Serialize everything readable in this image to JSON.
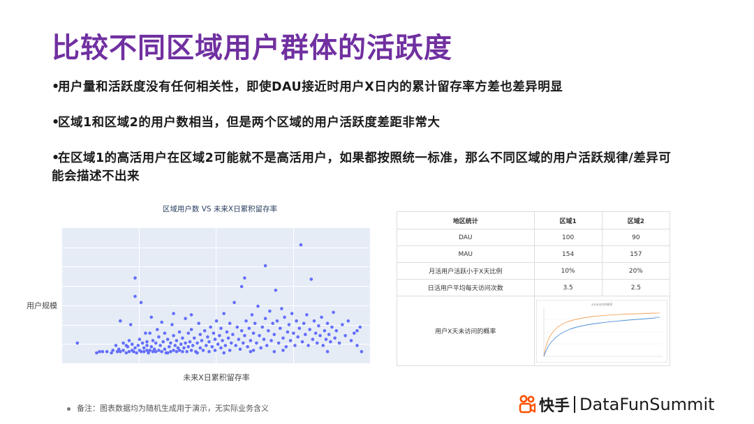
{
  "slide": {
    "title": "比较不同区域用户群体的活跃度",
    "bullets": [
      "用户量和活跃度没有任何相关性，即使DAU接近时用户X日内的累计留存率方差也差异明显",
      "区域1和区域2的用户数相当，但是两个区域的用户活跃度差距非常大",
      "在区域1的高活用户在区域2可能就不是高活用户，如果都按照统一标准，那么不同区域的用户活跃规律/差异可能会描述不出来"
    ],
    "bullet_mark": "•"
  },
  "chart_data": {
    "type": "scatter",
    "title": "区域用户数 VS 未来X日累积留存率",
    "xlabel": "未来X日累积留存率",
    "ylabel": "用户规模",
    "grid": true,
    "background": "#e5ecf6",
    "marker_color": "#636efa",
    "x_range": [
      0,
      1
    ],
    "y_range": [
      0,
      1
    ],
    "points": [
      [
        0.035,
        0.12
      ],
      [
        0.11,
        0.05
      ],
      [
        0.135,
        0.05
      ],
      [
        0.155,
        0.06
      ],
      [
        0.165,
        0.1
      ],
      [
        0.17,
        0.05
      ],
      [
        0.175,
        0.07
      ],
      [
        0.18,
        0.05
      ],
      [
        0.19,
        0.12
      ],
      [
        0.19,
        0.06
      ],
      [
        0.2,
        0.04
      ],
      [
        0.205,
        0.09
      ],
      [
        0.21,
        0.05
      ],
      [
        0.21,
        0.14
      ],
      [
        0.22,
        0.06
      ],
      [
        0.22,
        0.11
      ],
      [
        0.225,
        0.05
      ],
      [
        0.23,
        0.08
      ],
      [
        0.235,
        0.04
      ],
      [
        0.24,
        0.1
      ],
      [
        0.245,
        0.06
      ],
      [
        0.245,
        0.15
      ],
      [
        0.25,
        0.05
      ],
      [
        0.255,
        0.12
      ],
      [
        0.26,
        0.08
      ],
      [
        0.26,
        0.05
      ],
      [
        0.265,
        0.2
      ],
      [
        0.27,
        0.06
      ],
      [
        0.27,
        0.1
      ],
      [
        0.275,
        0.04
      ],
      [
        0.28,
        0.06
      ],
      [
        0.285,
        0.09
      ],
      [
        0.29,
        0.05
      ],
      [
        0.29,
        0.14
      ],
      [
        0.295,
        0.07
      ],
      [
        0.3,
        0.05
      ],
      [
        0.3,
        0.12
      ],
      [
        0.305,
        0.23
      ],
      [
        0.31,
        0.06
      ],
      [
        0.31,
        0.17
      ],
      [
        0.315,
        0.1
      ],
      [
        0.32,
        0.05
      ],
      [
        0.325,
        0.13
      ],
      [
        0.33,
        0.07
      ],
      [
        0.33,
        0.2
      ],
      [
        0.335,
        0.04
      ],
      [
        0.34,
        0.15
      ],
      [
        0.345,
        0.09
      ],
      [
        0.35,
        0.05
      ],
      [
        0.35,
        0.12
      ],
      [
        0.355,
        0.27
      ],
      [
        0.36,
        0.06
      ],
      [
        0.36,
        0.18
      ],
      [
        0.365,
        0.1
      ],
      [
        0.37,
        0.05
      ],
      [
        0.37,
        0.14
      ],
      [
        0.375,
        0.08
      ],
      [
        0.38,
        0.06
      ],
      [
        0.38,
        0.21
      ],
      [
        0.385,
        0.11
      ],
      [
        0.39,
        0.05
      ],
      [
        0.39,
        0.16
      ],
      [
        0.395,
        0.08
      ],
      [
        0.4,
        0.32
      ],
      [
        0.4,
        0.12
      ],
      [
        0.405,
        0.05
      ],
      [
        0.41,
        0.2
      ],
      [
        0.41,
        0.09
      ],
      [
        0.415,
        0.13
      ],
      [
        0.42,
        0.06
      ],
      [
        0.42,
        0.23
      ],
      [
        0.425,
        0.1
      ],
      [
        0.43,
        0.16
      ],
      [
        0.435,
        0.05
      ],
      [
        0.44,
        0.12
      ],
      [
        0.445,
        0.28
      ],
      [
        0.45,
        0.08
      ],
      [
        0.45,
        0.19
      ],
      [
        0.455,
        0.14
      ],
      [
        0.46,
        0.06
      ],
      [
        0.465,
        0.22
      ],
      [
        0.47,
        0.1
      ],
      [
        0.475,
        0.17
      ],
      [
        0.48,
        0.05
      ],
      [
        0.48,
        0.13
      ],
      [
        0.485,
        0.25
      ],
      [
        0.49,
        0.09
      ],
      [
        0.495,
        0.2
      ],
      [
        0.5,
        0.15
      ],
      [
        0.5,
        0.06
      ],
      [
        0.505,
        0.3
      ],
      [
        0.51,
        0.11
      ],
      [
        0.515,
        0.18
      ],
      [
        0.52,
        0.24
      ],
      [
        0.52,
        0.08
      ],
      [
        0.525,
        0.14
      ],
      [
        0.53,
        0.36
      ],
      [
        0.535,
        0.1
      ],
      [
        0.54,
        0.21
      ],
      [
        0.545,
        0.16
      ],
      [
        0.55,
        0.06
      ],
      [
        0.55,
        0.28
      ],
      [
        0.555,
        0.12
      ],
      [
        0.56,
        0.19
      ],
      [
        0.565,
        0.45
      ],
      [
        0.57,
        0.1
      ],
      [
        0.575,
        0.25
      ],
      [
        0.58,
        0.15
      ],
      [
        0.585,
        0.07
      ],
      [
        0.59,
        0.22
      ],
      [
        0.59,
        0.58
      ],
      [
        0.595,
        0.12
      ],
      [
        0.6,
        0.18
      ],
      [
        0.6,
        0.65
      ],
      [
        0.605,
        0.3
      ],
      [
        0.61,
        0.09
      ],
      [
        0.615,
        0.24
      ],
      [
        0.62,
        0.14
      ],
      [
        0.625,
        0.35
      ],
      [
        0.63,
        0.06
      ],
      [
        0.63,
        0.2
      ],
      [
        0.635,
        0.28
      ],
      [
        0.64,
        0.12
      ],
      [
        0.645,
        0.42
      ],
      [
        0.65,
        0.18
      ],
      [
        0.655,
        0.08
      ],
      [
        0.66,
        0.25
      ],
      [
        0.665,
        0.15
      ],
      [
        0.67,
        0.32
      ],
      [
        0.67,
        0.75
      ],
      [
        0.675,
        0.1
      ],
      [
        0.68,
        0.22
      ],
      [
        0.685,
        0.38
      ],
      [
        0.69,
        0.14
      ],
      [
        0.695,
        0.28
      ],
      [
        0.7,
        0.05
      ],
      [
        0.7,
        0.19
      ],
      [
        0.705,
        0.55
      ],
      [
        0.71,
        0.3
      ],
      [
        0.715,
        0.12
      ],
      [
        0.72,
        0.24
      ],
      [
        0.725,
        0.4
      ],
      [
        0.73,
        0.16
      ],
      [
        0.735,
        0.33
      ],
      [
        0.74,
        0.09
      ],
      [
        0.745,
        0.21
      ],
      [
        0.75,
        0.27
      ],
      [
        0.755,
        0.14
      ],
      [
        0.76,
        0.36
      ],
      [
        0.765,
        0.2
      ],
      [
        0.77,
        0.1
      ],
      [
        0.775,
        0.3
      ],
      [
        0.78,
        0.17
      ],
      [
        0.785,
        0.24
      ],
      [
        0.79,
        0.92
      ],
      [
        0.795,
        0.13
      ],
      [
        0.8,
        0.28
      ],
      [
        0.805,
        0.19
      ],
      [
        0.81,
        0.35
      ],
      [
        0.815,
        0.1
      ],
      [
        0.82,
        0.23
      ],
      [
        0.825,
        0.64
      ],
      [
        0.83,
        0.15
      ],
      [
        0.835,
        0.3
      ],
      [
        0.84,
        0.2
      ],
      [
        0.845,
        0.12
      ],
      [
        0.85,
        0.26
      ],
      [
        0.855,
        0.18
      ],
      [
        0.86,
        0.33
      ],
      [
        0.865,
        0.1
      ],
      [
        0.87,
        0.22
      ],
      [
        0.875,
        0.15
      ],
      [
        0.88,
        0.28
      ],
      [
        0.885,
        0.19
      ],
      [
        0.89,
        0.13
      ],
      [
        0.895,
        0.25
      ],
      [
        0.9,
        0.37
      ],
      [
        0.905,
        0.16
      ],
      [
        0.91,
        0.22
      ],
      [
        0.92,
        0.12
      ],
      [
        0.93,
        0.27
      ],
      [
        0.94,
        0.18
      ],
      [
        0.95,
        0.3
      ],
      [
        0.96,
        0.14
      ],
      [
        0.97,
        0.2
      ],
      [
        0.98,
        0.1
      ],
      [
        0.99,
        0.25
      ],
      [
        0.995,
        0.05
      ],
      [
        0.98,
        0.22
      ],
      [
        0.88,
        0.05
      ],
      [
        0.73,
        0.06
      ],
      [
        0.62,
        0.05
      ],
      [
        0.53,
        0.04
      ],
      [
        0.44,
        0.04
      ],
      [
        0.34,
        0.04
      ],
      [
        0.27,
        0.13
      ],
      [
        0.2,
        0.1
      ],
      [
        0.15,
        0.04
      ],
      [
        0.12,
        0.05
      ],
      [
        0.1,
        0.04
      ],
      [
        0.23,
        0.65
      ],
      [
        0.23,
        0.5
      ],
      [
        0.215,
        0.27
      ],
      [
        0.285,
        0.33
      ],
      [
        0.36,
        0.36
      ],
      [
        0.25,
        0.45
      ],
      [
        0.32,
        0.29
      ],
      [
        0.18,
        0.3
      ],
      [
        0.28,
        0.2
      ],
      [
        0.42,
        0.35
      ]
    ]
  },
  "table": {
    "headers": [
      "地区统计",
      "区域1",
      "区域2"
    ],
    "rows": [
      [
        "DAU",
        "100",
        "90"
      ],
      [
        "MAU",
        "154",
        "157"
      ],
      [
        "月活用户活跃小于X天比例",
        "10%",
        "20%"
      ],
      [
        "日活用户平均每天访问次数",
        "3.5",
        "2.5"
      ]
    ],
    "chart_row_label": "用户X天未访问的概率",
    "mini_chart": {
      "title": "x天未访问的概率",
      "series_colors": [
        "#f4a259",
        "#4a90d9"
      ]
    }
  },
  "footnote": "备注：图表数据均为随机生成用于演示，无实际业务含义",
  "logo": {
    "kuaishou_text": "快手",
    "datafun_text": "DataFunSummit",
    "brand_color": "#ff5000"
  }
}
